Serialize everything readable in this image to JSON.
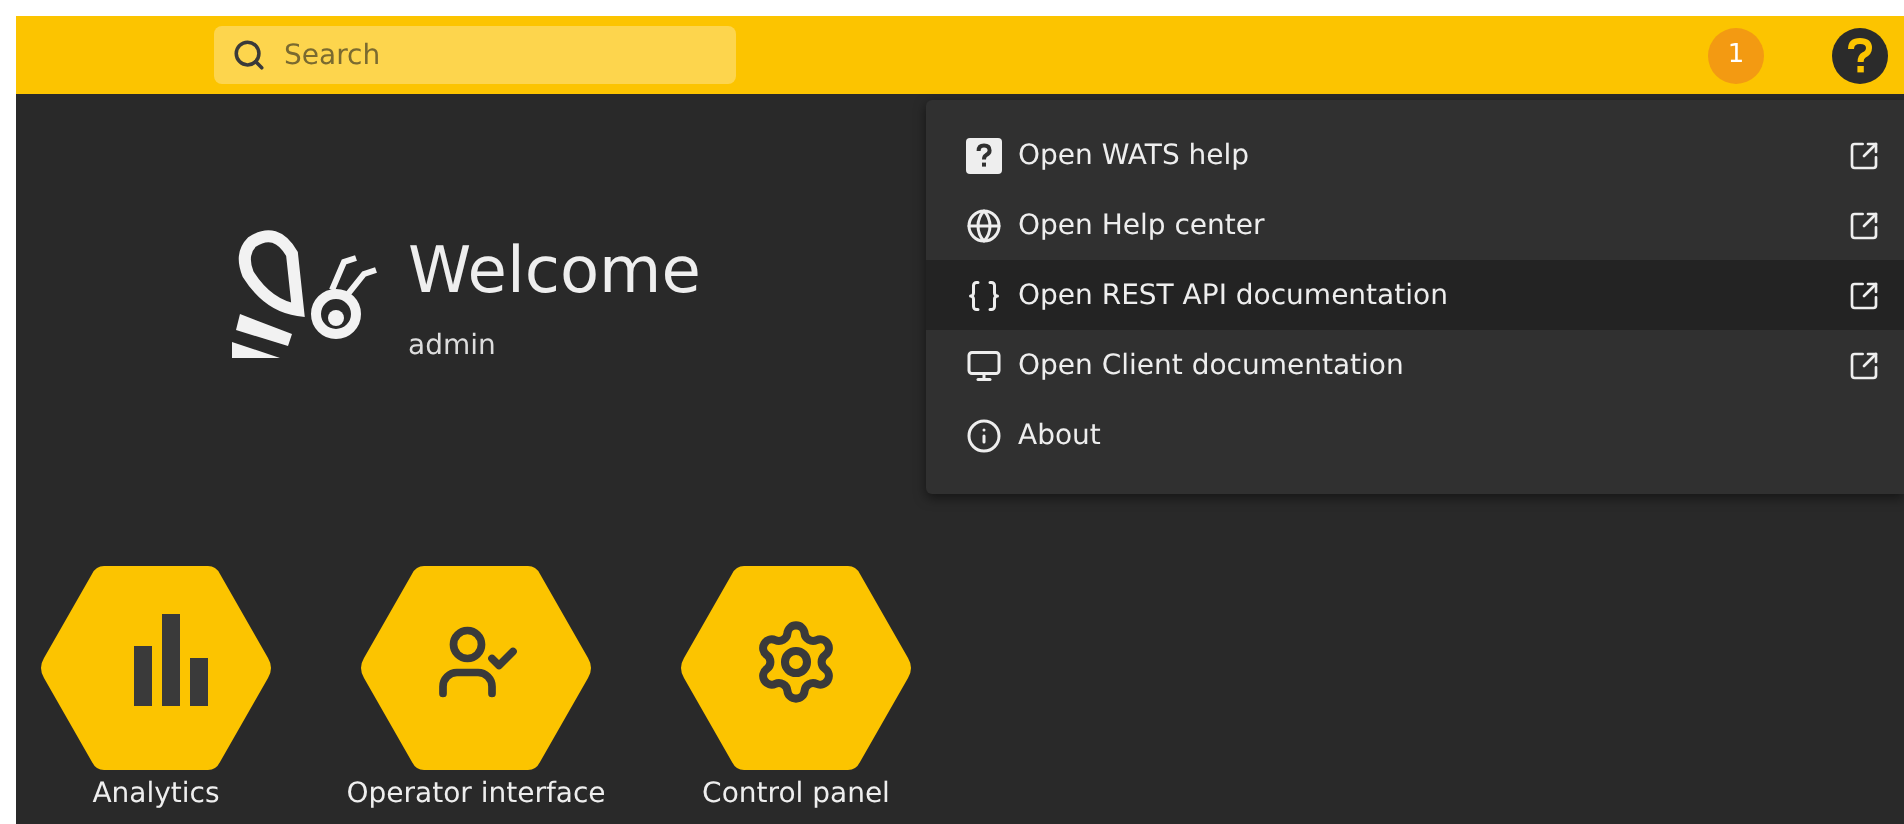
{
  "top_bar": {
    "search": {
      "placeholder": "Search"
    },
    "notification_count": "1"
  },
  "welcome": {
    "title": "Welcome",
    "user": "admin"
  },
  "tiles": [
    {
      "kind": "analytics",
      "label": "Analytics"
    },
    {
      "kind": "operator",
      "label": "Operator interface"
    },
    {
      "kind": "control",
      "label": "Control panel"
    }
  ],
  "help_menu": {
    "items": [
      {
        "kind": "help",
        "label": "Open WATS help",
        "external": true,
        "selected": false
      },
      {
        "kind": "globe",
        "label": "Open Help center",
        "external": true,
        "selected": false
      },
      {
        "kind": "api",
        "label": "Open REST API documentation",
        "external": true,
        "selected": true
      },
      {
        "kind": "client",
        "label": "Open Client documentation",
        "external": true,
        "selected": false
      },
      {
        "kind": "info",
        "label": "About",
        "external": false,
        "selected": false
      }
    ]
  }
}
